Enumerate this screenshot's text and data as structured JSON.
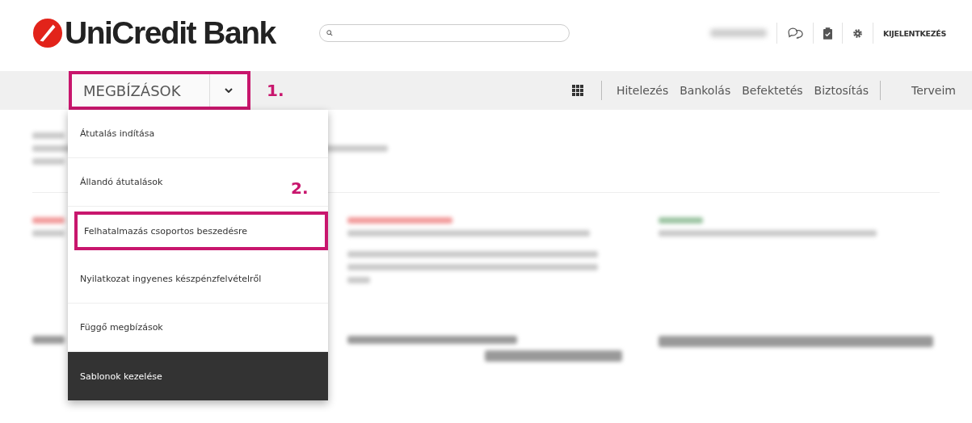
{
  "header": {
    "logo": "UniCredit Bank",
    "logout": "KIJELENTKEZÉS"
  },
  "nav": {
    "menu_button": {
      "label": "MEGBÍZÁSOK",
      "expanded": true,
      "highlighted": true
    },
    "step_label": "1.",
    "links": [
      "Hitelezés",
      "Bankolás",
      "Befektetés",
      "Biztosítás"
    ],
    "extra_link": "Terveim"
  },
  "dropdown": {
    "step_label": "2.",
    "items": [
      {
        "label": "Átutalás indítása",
        "selected": false,
        "highlighted": false
      },
      {
        "label": "Állandó átutalások",
        "selected": false,
        "highlighted": false
      },
      {
        "label": "Felhatalmazás csoportos beszedésre",
        "selected": false,
        "highlighted": true
      },
      {
        "label": "Nyilatkozat ingyenes készpénzfelvételről",
        "selected": false,
        "highlighted": false
      },
      {
        "label": "Függő megbízások",
        "selected": false,
        "highlighted": false
      },
      {
        "label": "Sablonok kezelése",
        "selected": true,
        "highlighted": false
      }
    ]
  }
}
